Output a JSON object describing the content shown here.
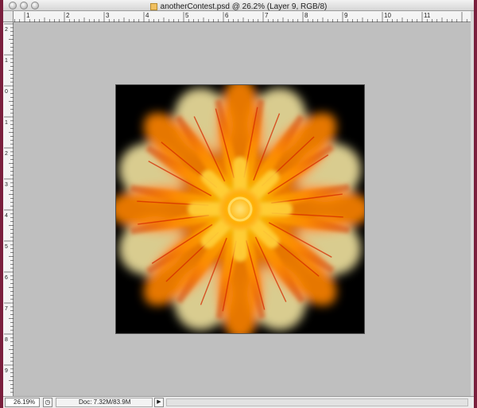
{
  "window": {
    "title": "anotherContest.psd @ 26.2% (Layer 9, RGB/8)",
    "icons": {
      "document": "psd-document-icon"
    }
  },
  "rulers": {
    "top_labels": [
      "1",
      "2",
      "3",
      "4",
      "5",
      "6",
      "7",
      "8",
      "9",
      "10",
      "11"
    ],
    "left_labels": [
      "2",
      "1",
      "0",
      "1",
      "2",
      "3",
      "4",
      "5",
      "6",
      "7",
      "8",
      "9"
    ]
  },
  "canvas": {
    "background_color": "#bfbfbf",
    "artwork": {
      "dominant_colors": [
        "#ff8a00",
        "#ffd200",
        "#fff3b0",
        "#d83a00",
        "#000000"
      ]
    }
  },
  "status": {
    "zoom": "26.19%",
    "doc_info": "Doc: 7.32M/83.9M",
    "arrow": "▶",
    "icon": "status-preview-icon"
  }
}
